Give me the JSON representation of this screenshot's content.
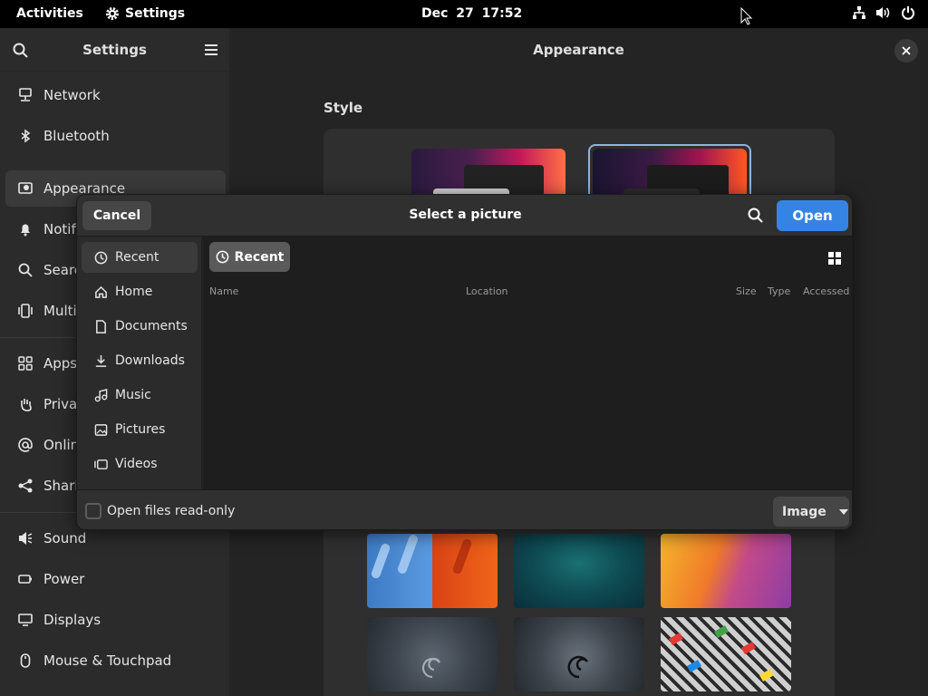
{
  "topbar": {
    "activities": "Activities",
    "app_name": "Settings",
    "date": "Dec 27",
    "time": "17:52",
    "icons": [
      "network-icon",
      "volume-icon",
      "power-icon"
    ]
  },
  "settings": {
    "sidebar_title": "Settings",
    "items": [
      {
        "label": "Network",
        "icon": "network-icon"
      },
      {
        "label": "Bluetooth",
        "icon": "bluetooth-icon"
      },
      {
        "label": "Appearance",
        "icon": "appearance-icon",
        "active": true
      },
      {
        "label": "Notifi",
        "icon": "bell-icon"
      },
      {
        "label": "Searc",
        "icon": "search-icon"
      },
      {
        "label": "Multi",
        "icon": "multitasking-icon"
      },
      {
        "label": "Apps",
        "icon": "apps-icon"
      },
      {
        "label": "Priva",
        "icon": "hand-icon"
      },
      {
        "label": "Onlin",
        "icon": "at-icon"
      },
      {
        "label": "Shari",
        "icon": "share-icon"
      },
      {
        "label": "Sound",
        "icon": "speaker-icon"
      },
      {
        "label": "Power",
        "icon": "battery-icon"
      },
      {
        "label": "Displays",
        "icon": "display-icon"
      },
      {
        "label": "Mouse & Touchpad",
        "icon": "mouse-icon"
      }
    ],
    "main_title": "Appearance",
    "style_label": "Style"
  },
  "dialog": {
    "title": "Select a picture",
    "cancel": "Cancel",
    "open": "Open",
    "places": [
      {
        "label": "Recent",
        "icon": "clock-icon",
        "active": true
      },
      {
        "label": "Home",
        "icon": "home-icon"
      },
      {
        "label": "Documents",
        "icon": "document-icon"
      },
      {
        "label": "Downloads",
        "icon": "download-icon"
      },
      {
        "label": "Music",
        "icon": "music-icon"
      },
      {
        "label": "Pictures",
        "icon": "image-icon"
      },
      {
        "label": "Videos",
        "icon": "video-icon"
      }
    ],
    "path_button": "Recent",
    "columns": {
      "name": "Name",
      "location": "Location",
      "size": "Size",
      "type": "Type",
      "accessed": "Accessed"
    },
    "readonly_label": "Open files read-only",
    "filter": "Image"
  },
  "colors": {
    "accent": "#3584e4",
    "topbar": "#000000",
    "sidebar": "#2b2b2b"
  }
}
